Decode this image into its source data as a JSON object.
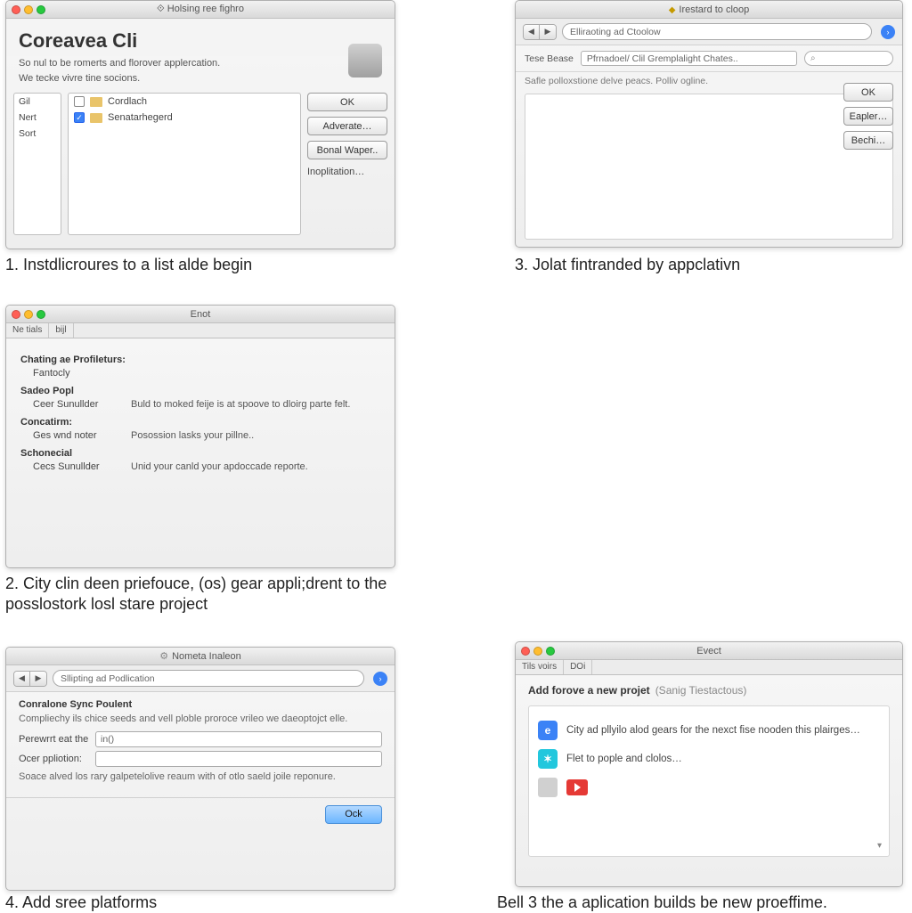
{
  "panel1": {
    "titlebar": "Holsing ree fighro",
    "sub_prefix": "⟐",
    "heading": "Coreavea Cli",
    "desc_line1": "So nul to be romerts and florover applercation.",
    "desc_line2": "We tecke vivre tine socions.",
    "side_items": [
      "Gil",
      "Nert",
      "Sort"
    ],
    "files": [
      {
        "checked": false,
        "label": "Cordlach"
      },
      {
        "checked": true,
        "label": "Senatarhegerd"
      }
    ],
    "buttons": {
      "ok": "OK",
      "adv": "Adverate…",
      "bonal": "Bonal Waper..",
      "inop": "Inoplitation…"
    }
  },
  "caption1": "1. Instdlicroures to a list alde begin",
  "panel2": {
    "titlebar": "Enot",
    "tabs": [
      "Ne tials",
      "bijl"
    ],
    "groups": [
      {
        "title": "Chating ae Profileturs:",
        "rows": [
          {
            "label": "Fantocly",
            "value": ""
          }
        ]
      },
      {
        "title": "Sadeo Popl",
        "rows": [
          {
            "label": "Ceer Sunullder",
            "value": "Buld to moked feije is at spoove to dloirg parte felt."
          }
        ]
      },
      {
        "title": "Concatirm:",
        "rows": [
          {
            "label": "Ges wnd noter",
            "value": "Posossion lasks your pillne.."
          }
        ]
      },
      {
        "title": "Schonecial",
        "rows": [
          {
            "label": "Cecs Sunullder",
            "value": "Unid your canld your apdoccade reporte."
          }
        ]
      }
    ]
  },
  "caption2": "2. City clin deen priefouce, (os) gear appli;drent to the posslostork losl stare project",
  "panel3": {
    "titlebar": "Irestard to cloop",
    "bookmark_icon": "◆",
    "search": "Elliraoting ad Ctoolow",
    "row2_label": "Tese Bease",
    "row2_field": "Pfrnadoel/ Clil Gremplalight Chates..",
    "row2_search_icon": "⌕",
    "info": "Safle polloxstione delve peacs. Polliv ogline.",
    "buttons": {
      "ok": "OK",
      "eapler": "Eapler…",
      "bechi": "Bechi…"
    }
  },
  "caption3": "3. Jolat fintranded by appclativn",
  "panel4": {
    "titlebar": "Nometa Inaleon",
    "gear_icon": "⚙",
    "search": "Sllipting ad Podlication",
    "form_title": "Conralone Sync Poulent",
    "form_desc": "Compliechy ils chice seeds and vell ploble proroce vrileo we daeoptojct elle.",
    "field1_label": "Perewrrt eat the",
    "field1_value": "in()",
    "field2_label": "Ocer ppliotion:",
    "note": "Soace alved los rary galpetelolive reaum with of otlo saeld joile reponure.",
    "ok": "Ock"
  },
  "caption4": "4. Add sree platforms",
  "panel5": {
    "titlebar": "Evect",
    "tabs": [
      "Tils voirs",
      "DOi"
    ],
    "header_bold": "Add forove a new projet",
    "header_sub": "(Sanig Tiestactous)",
    "items": [
      {
        "icon": "blue",
        "glyph": "e",
        "text": "City ad pllyilo alod gears for the nexct fise nooden this plairges…"
      },
      {
        "icon": "cyan",
        "glyph": "✶",
        "text": "Flet to pople and clolos…"
      }
    ],
    "chevron": "▾"
  },
  "caption5": "Bell 3 the a aplication builds be new proeffime."
}
